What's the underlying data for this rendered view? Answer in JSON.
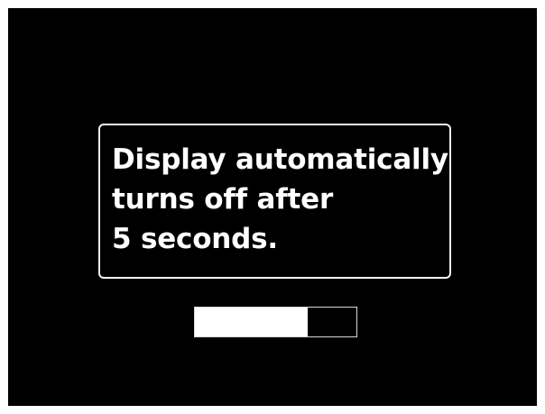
{
  "message": {
    "lines": [
      "Display automatically",
      "turns off after",
      "5 seconds."
    ]
  },
  "countdown": {
    "progress_fraction": 0.7
  },
  "colors": {
    "background": "#000000",
    "foreground": "#ffffff",
    "border": "#f2f2f2"
  }
}
